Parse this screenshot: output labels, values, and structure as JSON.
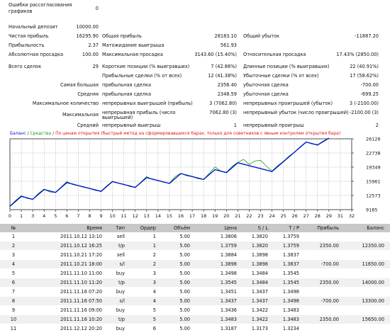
{
  "errors": {
    "label": "Ошибки рассогласования графиков",
    "value": "0"
  },
  "summary_rows": [
    [
      {
        "t": "Начальный депозит"
      },
      {
        "t": "10000.00",
        "n": 1
      }
    ],
    [
      {
        "t": "Чистая прибыль"
      },
      {
        "t": "16295.90",
        "n": 1
      },
      {
        "t": "Общая прибыль"
      },
      {
        "t": "28183.10",
        "n": 1
      },
      {
        "t": "Общий убыток"
      },
      {
        "t": "-11887.20",
        "n": 1
      }
    ],
    [
      {
        "t": "Прибыльность"
      },
      {
        "t": "2.37",
        "n": 1
      },
      {
        "t": "Матожидание выигрыша"
      },
      {
        "t": "561.93",
        "n": 1
      }
    ],
    [
      {
        "t": "Абсолютная просадка"
      },
      {
        "t": "100.00",
        "n": 1
      },
      {
        "t": "Максимальная просадка"
      },
      {
        "t": "3143.60 (15.40%)",
        "n": 1
      },
      {
        "t": "Относительная просадка"
      },
      {
        "t": "17.43% (2850.00)",
        "n": 1
      }
    ],
    [],
    [
      {
        "t": "Всего сделок"
      },
      {
        "t": "29",
        "n": 1
      },
      {
        "t": "Короткие позиции (% выигравших)"
      },
      {
        "t": "7 (42.86%)",
        "n": 1
      },
      {
        "t": "Длинные позиции (% выигравших)"
      },
      {
        "t": "22 (40.91%)",
        "n": 1
      }
    ],
    [
      null,
      null,
      {
        "t": "Прибыльные сделки (% от всех)"
      },
      {
        "t": "12 (41.38%)",
        "n": 1
      },
      {
        "t": "Убыточные сделки (% от всех)"
      },
      {
        "t": "17 (58.62%)",
        "n": 1
      }
    ],
    [
      {
        "t": "Самая большая",
        "n": 1
      },
      null,
      {
        "t": "прибыльная сделка"
      },
      {
        "t": "2356.40",
        "n": 1
      },
      {
        "t": "убыточная сделка"
      },
      {
        "t": "-700.00",
        "n": 1
      }
    ],
    [
      {
        "t": "Средняя",
        "n": 1
      },
      null,
      {
        "t": "прибыльная сделка"
      },
      {
        "t": "2348.59",
        "n": 1
      },
      {
        "t": "убыточная сделка"
      },
      {
        "t": "-699.25",
        "n": 1
      }
    ],
    [
      {
        "t": "Максимальное количество",
        "n": 1
      },
      null,
      {
        "t": "непрерывных выигрышей (прибыль)"
      },
      {
        "t": "3 (7062.80)",
        "n": 1
      },
      {
        "t": "непрерывных проигрышей (убыток)"
      },
      {
        "t": "3 (-2100.00)",
        "n": 1
      }
    ],
    [
      {
        "t": "Максимальная",
        "n": 1
      },
      null,
      {
        "t": "непрерывная прибыль (число выигрышей)"
      },
      {
        "t": "7062.80 (3)",
        "n": 1
      },
      {
        "t": "непрерывный убыток (число проигрышей)"
      },
      {
        "t": "-2100.00 (3)",
        "n": 1
      }
    ],
    [
      {
        "t": "Средний",
        "n": 1
      },
      null,
      {
        "t": "непрерывный выигрыш"
      },
      {
        "t": "1",
        "n": 1
      },
      {
        "t": "непрерывный проигрыш"
      },
      {
        "t": "2",
        "n": 1
      }
    ]
  ],
  "chart_legend": {
    "balance": "Баланс",
    "sep": " / ",
    "equity": "Средства",
    "sep2": " / ",
    "note": "По ценам открытия (быстрый метод на сформировавшихся барах, только для советников с явным контролем открытия бара)"
  },
  "chart_data": {
    "type": "line",
    "title": "",
    "x_ticks": [
      "0",
      "1",
      "3",
      "4",
      "5",
      "6",
      "7",
      "8",
      "9",
      "10",
      "11",
      "12",
      "13",
      "14",
      "15",
      "16",
      "17",
      "18",
      "19",
      "20",
      "21",
      "22",
      "23",
      "24",
      "25",
      "26",
      "27",
      "28",
      "29",
      "31",
      "32"
    ],
    "y_ticks": [
      "26126",
      "22738",
      "19349",
      "15961",
      "12573",
      "9185"
    ],
    "ylim": [
      9185,
      26126
    ],
    "xlim": [
      0,
      30
    ],
    "series": [
      {
        "name": "Баланс",
        "color": "#0018c8",
        "x": [
          0,
          1,
          2,
          3,
          4,
          5,
          6,
          7,
          8,
          9,
          10,
          11,
          12,
          13,
          14,
          15,
          16,
          17,
          18,
          19,
          20,
          21,
          22,
          23,
          24,
          25,
          26,
          27,
          28
        ],
        "values": [
          10000,
          12350,
          11650,
          14000,
          13300,
          15650,
          14950,
          14250,
          13550,
          15900,
          15200,
          14500,
          16850,
          16150,
          15450,
          17800,
          17100,
          16400,
          18750,
          18050,
          20400,
          19700,
          19000,
          18300,
          20650,
          23000,
          25350,
          24650,
          26296
        ]
      },
      {
        "name": "Средства",
        "color": "#1a9a1a",
        "x": [
          0,
          0.5,
          1,
          1.5,
          2,
          2.5,
          3,
          3.5,
          4,
          4.5,
          5,
          5.5,
          6,
          6.5,
          7,
          7.5,
          8,
          8.5,
          9,
          9.5,
          10,
          10.5,
          11,
          11.5,
          12,
          12.5,
          13,
          13.5,
          14,
          14.5,
          15,
          15.5,
          16,
          16.5,
          17,
          17.5,
          18,
          18.5,
          19,
          19.5,
          20,
          20.5,
          21,
          21.5,
          22,
          22.5,
          23,
          23.5,
          24,
          24.5,
          25,
          25.5,
          26,
          26.5,
          27,
          27.5,
          28
        ],
        "values": [
          10000,
          11400,
          12500,
          11900,
          11600,
          13100,
          14100,
          13400,
          13300,
          14600,
          15900,
          15200,
          14900,
          14500,
          14300,
          13800,
          13600,
          14900,
          16000,
          15500,
          15300,
          14700,
          14500,
          15800,
          17100,
          16400,
          16200,
          15700,
          15500,
          17100,
          17900,
          17300,
          17100,
          16600,
          16400,
          17900,
          19400,
          18400,
          18100,
          19500,
          20500,
          21200,
          20000,
          20800,
          21000,
          19600,
          18400,
          19700,
          20700,
          22000,
          23000,
          24300,
          25400,
          24900,
          24700,
          25600,
          26296
        ]
      }
    ],
    "grid": true
  },
  "deals_columns": [
    "№",
    "Время",
    "Тип",
    "Ордер",
    "Объём",
    "Цена",
    "S / L",
    "T / P",
    "Прибыль",
    "Баланс"
  ],
  "deals": [
    [
      "1",
      "2011.10.12 13:10",
      "sell",
      "1",
      "5.00",
      "1.3806",
      "1.3820",
      "1.3759",
      "",
      ""
    ],
    [
      "2",
      "2011.10.12 16:25",
      "t/p",
      "1",
      "5.00",
      "1.3759",
      "1.3820",
      "1.3759",
      "2350.00",
      "12350.00"
    ],
    [
      "3",
      "2011.10.21 17:20",
      "sell",
      "2",
      "5.00",
      "1.3884",
      "1.3898",
      "1.3837",
      "",
      ""
    ],
    [
      "4",
      "2011.10.21 18:00",
      "s/l",
      "2",
      "5.00",
      "1.3898",
      "1.3898",
      "1.3837",
      "-700.00",
      "11650.00"
    ],
    [
      "5",
      "2011.11.10 11:00",
      "buy",
      "3",
      "5.00",
      "1.3498",
      "1.3484",
      "1.3545",
      "",
      ""
    ],
    [
      "6",
      "2011.11.10 11:20",
      "t/p",
      "3",
      "5.00",
      "1.3545",
      "1.3484",
      "1.3545",
      "2350.00",
      "14000.00"
    ],
    [
      "7",
      "2011.11.16 07:20",
      "buy",
      "4",
      "5.00",
      "1.3451",
      "1.3437",
      "1.3498",
      "",
      ""
    ],
    [
      "8",
      "2011.11.16 07:50",
      "s/l",
      "4",
      "5.00",
      "1.3437",
      "1.3437",
      "1.3498",
      "-700.00",
      "13300.00"
    ],
    [
      "9",
      "2011.11.16 09:00",
      "buy",
      "5",
      "5.00",
      "1.3436",
      "1.3422",
      "1.3483",
      "",
      ""
    ],
    [
      "10",
      "2011.11.16 10:20",
      "t/p",
      "5",
      "5.00",
      "1.3483",
      "1.3422",
      "1.3483",
      "2350.00",
      "15650.00"
    ],
    [
      "11",
      "2011.12.12 20:20",
      "buy",
      "6",
      "5.00",
      "1.3187",
      "1.3173",
      "1.3234",
      "",
      ""
    ]
  ]
}
